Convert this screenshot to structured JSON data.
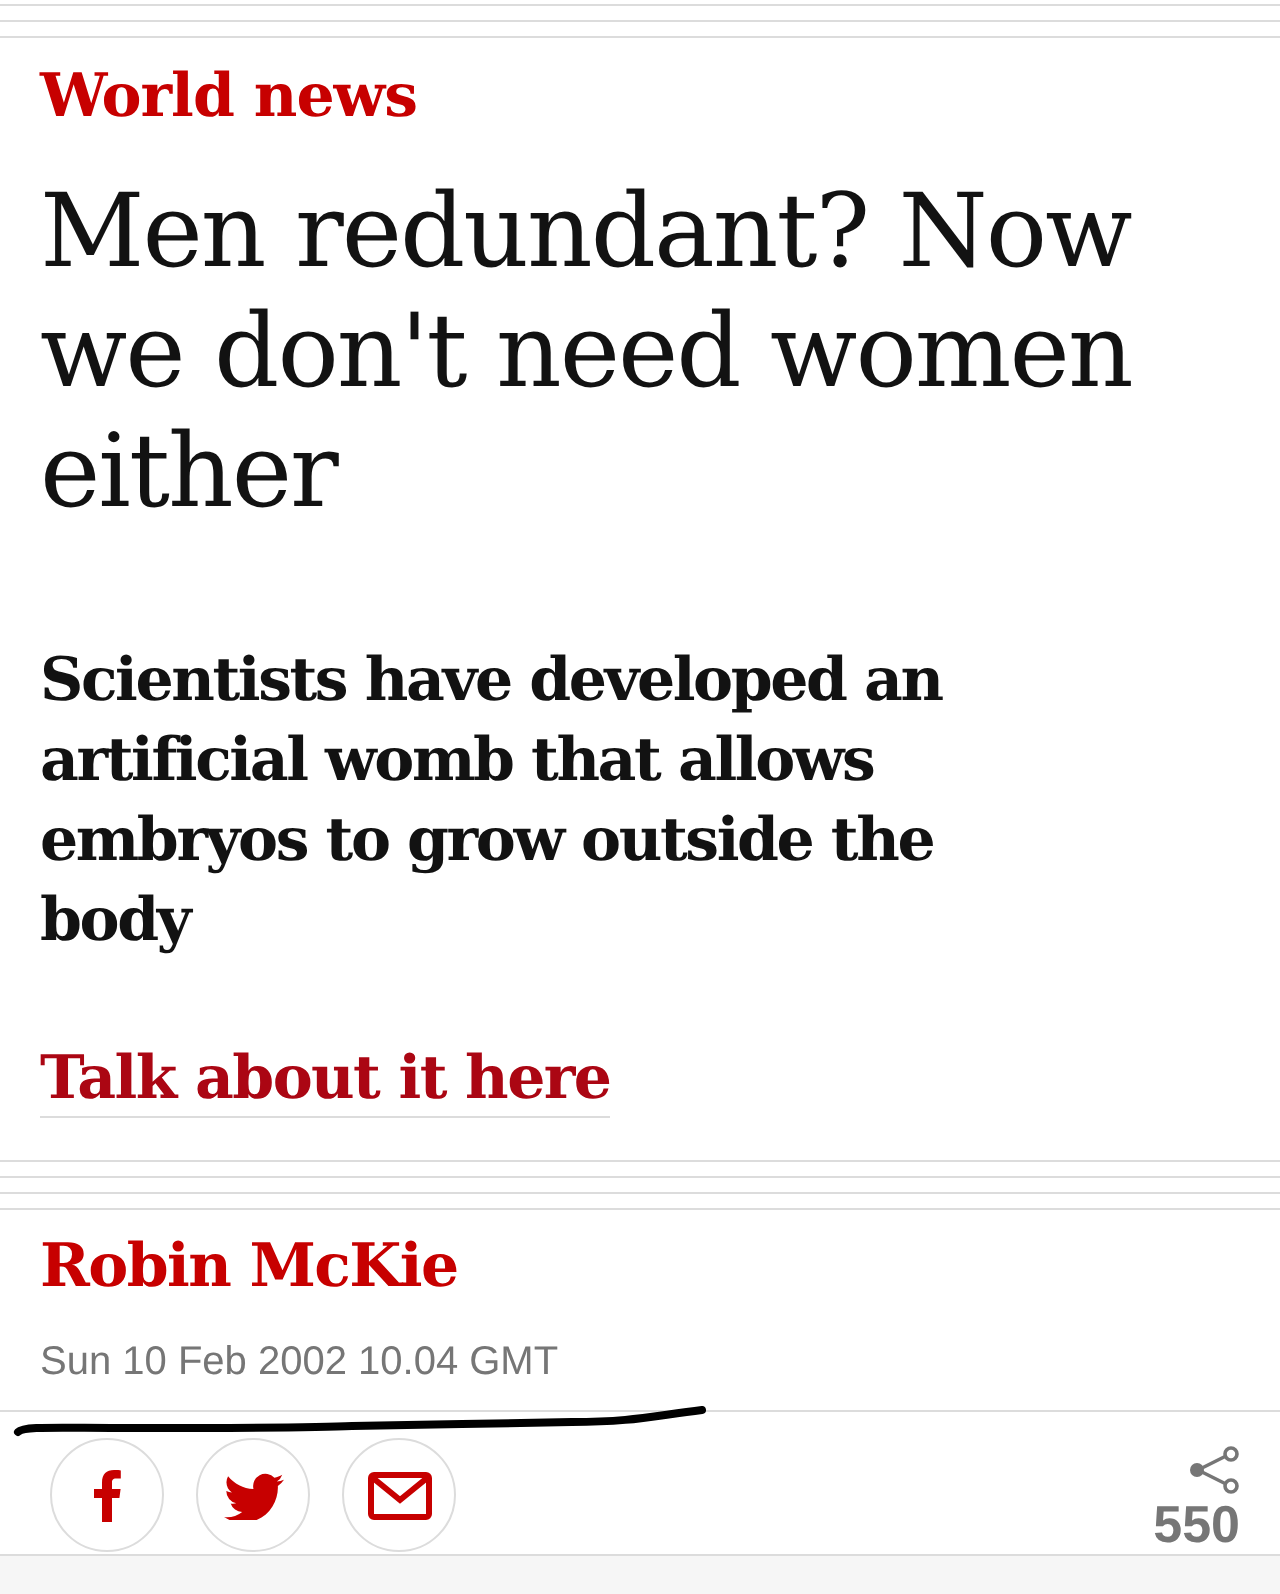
{
  "section": "World news",
  "headline": "Men redundant? Now we don't need women either",
  "standfirst": "Scientists have developed an artificial womb that allows embryos to grow outside the body",
  "discussion_link": "Talk about it here",
  "byline": {
    "author": "Robin McKie",
    "date": "Sun 10 Feb 2002 10.04 GMT"
  },
  "share": {
    "buttons": [
      {
        "kind": "facebook"
      },
      {
        "kind": "twitter"
      },
      {
        "kind": "email"
      }
    ],
    "count": "550"
  }
}
